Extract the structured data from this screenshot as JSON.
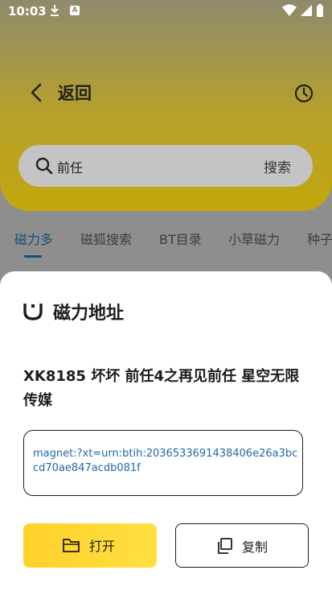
{
  "status_bar": {
    "time": "10:03"
  },
  "header": {
    "title": "返回",
    "search": {
      "value": "前任",
      "button_label": "搜索"
    }
  },
  "tabs": [
    "磁力多",
    "磁狐搜索",
    "BT目录",
    "小草磁力",
    "种子"
  ],
  "active_tab": 0,
  "sheet": {
    "title": "磁力地址",
    "torrent_name": "XK8185 坏坏 前任4之再见前任 星空无限传媒",
    "magnet": "magnet:?xt=urn:btih:2036533691438406e26a3bccd70ae847acdb081f",
    "open_label": "打开",
    "copy_label": "复制"
  },
  "colors": {
    "accent": "#ffd02a",
    "link": "#2368a8",
    "tab_active": "#1b4e73"
  }
}
